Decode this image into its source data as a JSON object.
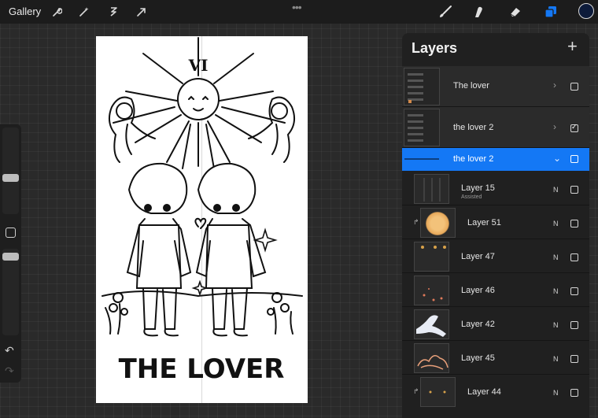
{
  "toolbar": {
    "gallery": "Gallery",
    "menu_dots": "•••",
    "color": "#0d1b3a",
    "accent": "#1478f5"
  },
  "canvas": {
    "card_numeral": "VI",
    "card_title": "THE LOVER"
  },
  "layers_panel": {
    "title": "Layers",
    "add_symbol": "+",
    "rows": [
      {
        "name": "The lover",
        "type": "group",
        "expanded": false,
        "visible": false
      },
      {
        "name": "the lover 2",
        "type": "group",
        "expanded": false,
        "visible": true
      },
      {
        "name": "the lover 2",
        "type": "group",
        "expanded": true,
        "selected": true,
        "visible": false
      },
      {
        "name": "Layer 15",
        "sub": "Assisted",
        "mode": "N",
        "visible": false
      },
      {
        "name": "Layer 51",
        "mode": "N",
        "clipped": true,
        "visible": false
      },
      {
        "name": "Layer 47",
        "mode": "N",
        "visible": false
      },
      {
        "name": "Layer 46",
        "mode": "N",
        "visible": false
      },
      {
        "name": "Layer 42",
        "mode": "N",
        "visible": false
      },
      {
        "name": "Layer 45",
        "mode": "N",
        "visible": false
      },
      {
        "name": "Layer 44",
        "mode": "N",
        "clipped": true,
        "visible": false
      }
    ]
  },
  "sidebar": {
    "undo_icon": "undo-icon",
    "redo_icon": "redo-icon"
  }
}
